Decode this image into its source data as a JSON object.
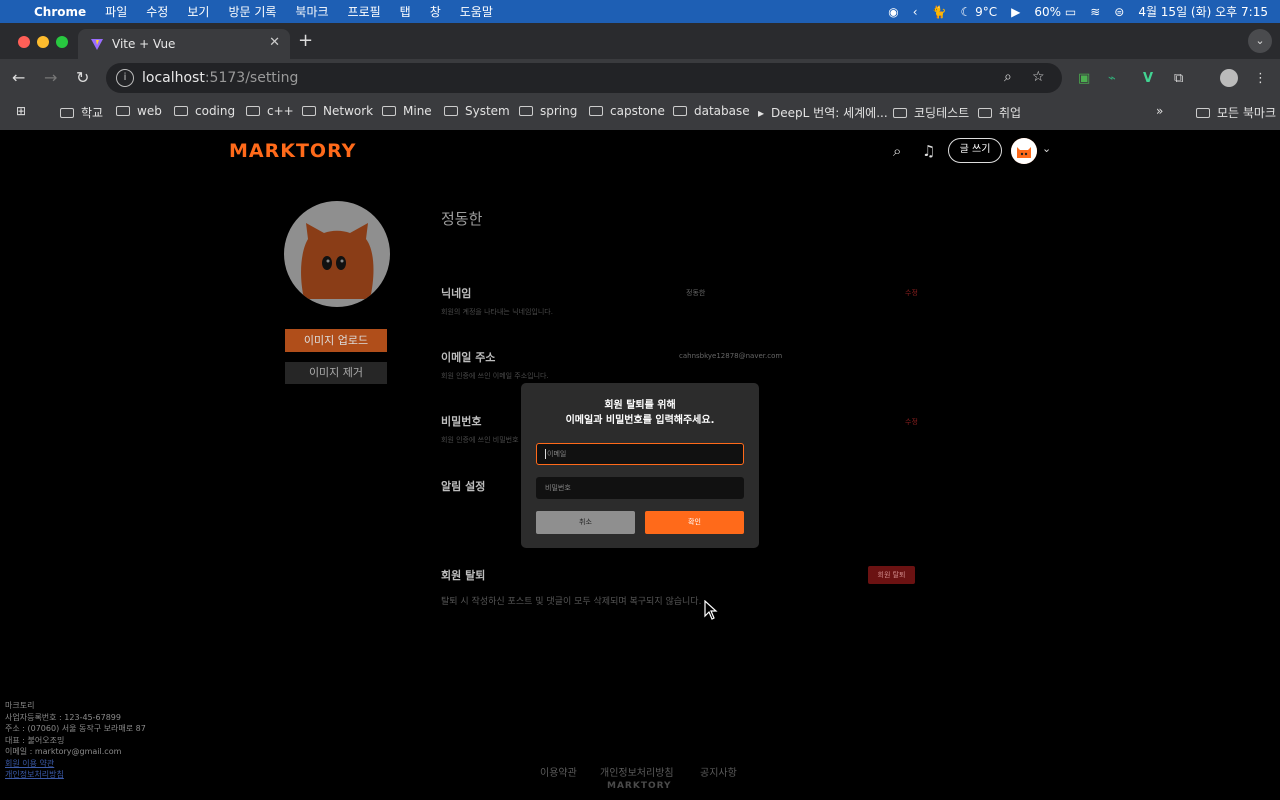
{
  "menubar": {
    "app": "Chrome",
    "items": [
      "파일",
      "수정",
      "보기",
      "방문 기록",
      "북마크",
      "프로필",
      "탭",
      "창",
      "도움말"
    ],
    "weather": "9°C",
    "battery": "60%",
    "datetime": "4월 15일 (화) 오후 7:15"
  },
  "browser": {
    "tab_title": "Vite + Vue",
    "url_host": "localhost",
    "url_path": ":5173/setting",
    "bookmarks": [
      "학교",
      "web",
      "coding",
      "c++",
      "Network",
      "Mine",
      "System",
      "spring",
      "capstone",
      "database",
      "DeepL 번역: 세계에...",
      "코딩테스트",
      "취업"
    ],
    "all_bookmarks": "모든 북마크"
  },
  "header": {
    "logo": "MARKTORY",
    "write_label": "글 쓰기"
  },
  "profile": {
    "name": "정동한",
    "upload_label": "이미지 업로드",
    "remove_label": "이미지 제거"
  },
  "settings": {
    "nickname_label": "닉네임",
    "nickname_desc": "회원의 계정을 나타내는 닉네임입니다.",
    "nickname_value": "정동한",
    "nickname_action": "수정",
    "email_label": "이메일 주소",
    "email_desc": "회원 인증에 쓰인 이메일 주소입니다.",
    "email_value": "cahnsbkye12878@naver.com",
    "password_label": "비밀번호",
    "password_desc": "회원 인증에 쓰인 비밀번호",
    "password_action": "수정",
    "notify_label": "알림 설정",
    "withdraw_label": "회원 탈퇴",
    "withdraw_button": "회원 탈퇴",
    "withdraw_desc": "탈퇴 시 작성하신 포스트 및 댓글이 모두 삭제되며 복구되지 않습니다."
  },
  "modal": {
    "title_line1": "회원 탈퇴를 위해",
    "title_line2": "이메일과 비밀번호를 입력해주세요.",
    "email_placeholder": "이메일",
    "password_placeholder": "비밀번호",
    "cancel_label": "취소",
    "confirm_label": "확인"
  },
  "footer": {
    "company": "마크토리",
    "biz_no": "사업자등록번호 : 123-45-67899",
    "address": "주소 : (07060) 서울 동작구 보라매로 87",
    "ceo": "대표 : 불어오조밍",
    "email": "이메일 : marktory@gmail.com",
    "terms_link": "회원 이용 약관",
    "privacy_link": "개인정보처리방침",
    "nav": [
      "이용약관",
      "개인정보처리방침",
      "공지사항"
    ],
    "logo": "MARKTORY"
  },
  "colors": {
    "accent": "#ff6a1a",
    "danger": "#6b1212"
  }
}
